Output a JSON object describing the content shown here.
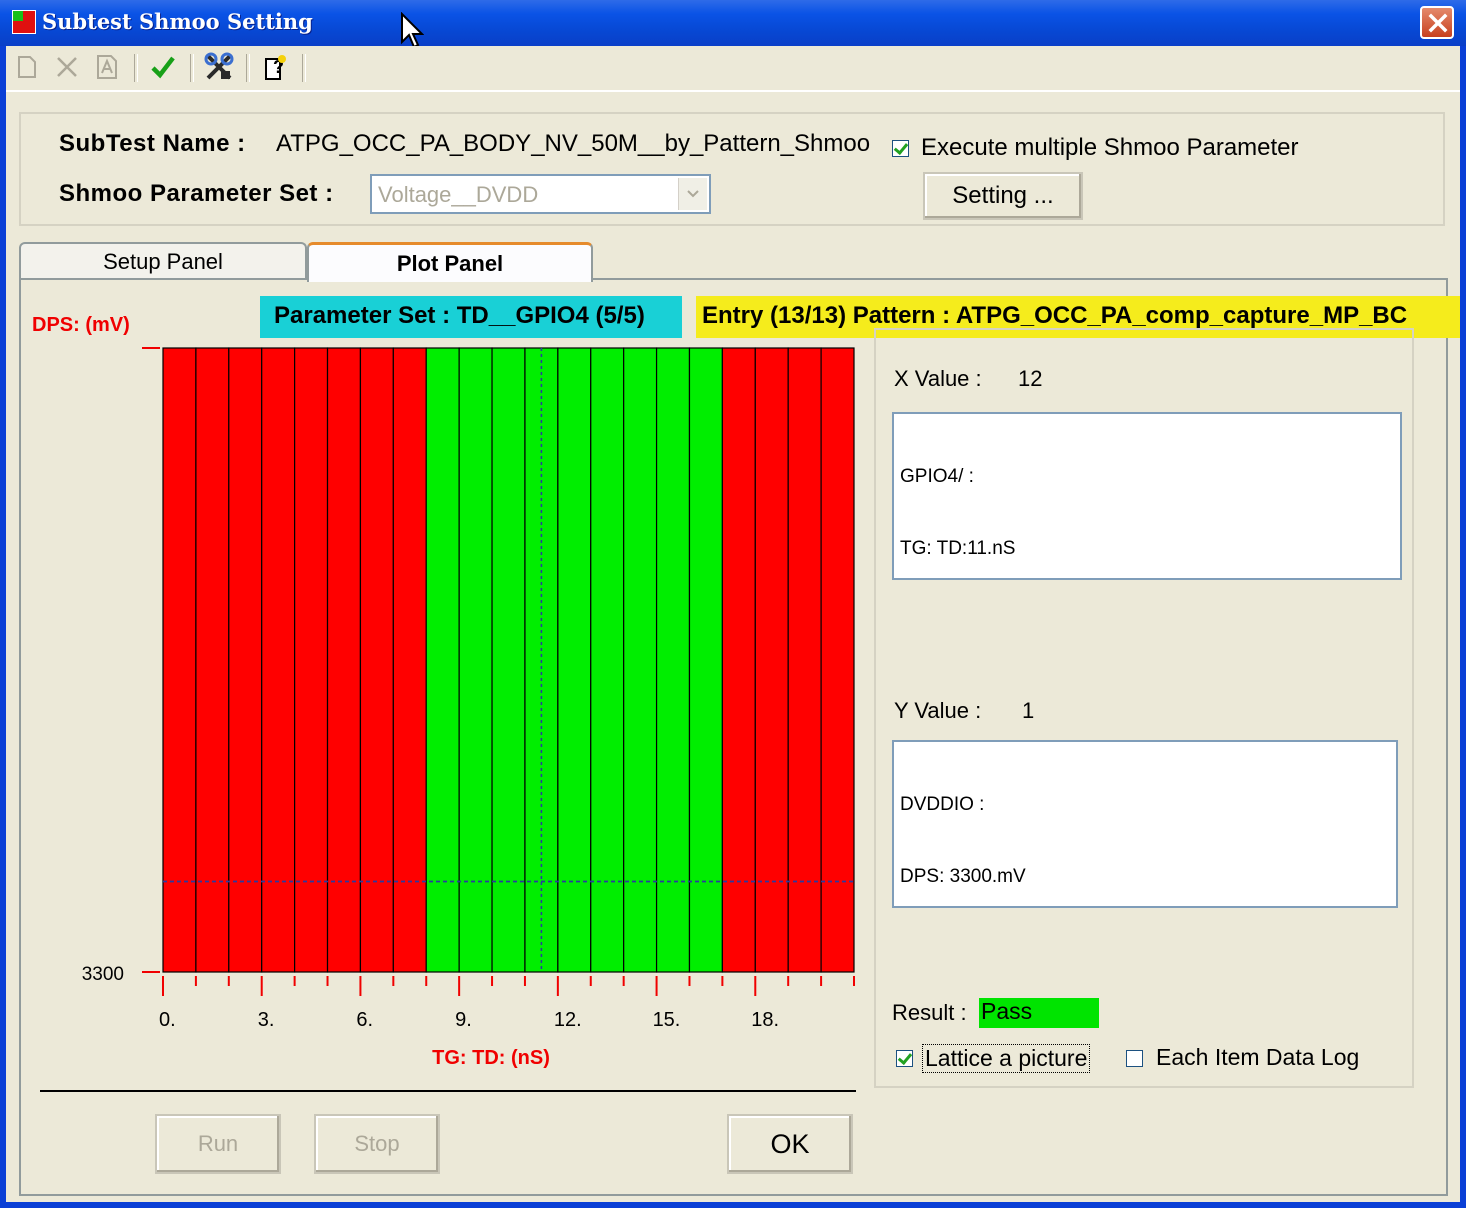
{
  "window": {
    "title": "Subtest Shmoo Setting"
  },
  "toolbar": {
    "icons": [
      "new-icon",
      "delete-icon",
      "rename-icon",
      "check-icon",
      "tools-icon",
      "help-icon"
    ]
  },
  "header": {
    "subtest_label": "SubTest Name :",
    "subtest_value": "ATPG_OCC_PA_BODY_NV_50M__by_Pattern_Shmoo",
    "param_set_label": "Shmoo Parameter Set :",
    "param_set_value": "Voltage__DVDD",
    "execute_multiple_label": "Execute multiple Shmoo Parameter",
    "execute_multiple_checked": true,
    "setting_button": "Setting ..."
  },
  "tabs": [
    {
      "label": "Setup Panel",
      "active": false
    },
    {
      "label": "Plot Panel",
      "active": true
    }
  ],
  "plot": {
    "parameter_set_banner": "Parameter Set : TD__GPIO4 (5/5)",
    "entry_banner": "Entry (13/13) Pattern : ATPG_OCC_PA_comp_capture_MP_BC",
    "dps_label": "DPS:  (mV)"
  },
  "chart_data": {
    "type": "heatmap",
    "xlabel": "TG: TD: (nS)",
    "ylabel": "DPS:  (mV)",
    "x_ticks": [
      "0.",
      "3.",
      "6.",
      "9.",
      "12.",
      "15.",
      "18."
    ],
    "y_ticks": [
      "3300"
    ],
    "x_range": [
      0,
      21
    ],
    "columns": 21,
    "results": [
      "fail",
      "fail",
      "fail",
      "fail",
      "fail",
      "fail",
      "fail",
      "fail",
      "pass",
      "pass",
      "pass",
      "pass",
      "pass",
      "pass",
      "pass",
      "pass",
      "pass",
      "fail",
      "fail",
      "fail",
      "fail"
    ],
    "colors": {
      "pass": "#00ee00",
      "fail": "#ff0000"
    },
    "cursor": {
      "x": 12,
      "y": 1
    }
  },
  "info": {
    "x_value_label": "X Value :",
    "x_value": "12",
    "x_memo_line1": "GPIO4/ :",
    "x_memo_line2": "TG: TD:11.nS",
    "y_value_label": "Y Value :",
    "y_value": "1",
    "y_memo_line1": "DVDDIO :",
    "y_memo_line2": "DPS: 3300.mV",
    "result_label": "Result :",
    "result_value": "Pass",
    "lattice_label": "Lattice a picture",
    "lattice_checked": true,
    "each_item_label": "Each Item Data Log",
    "each_item_checked": false
  },
  "buttons": {
    "run": "Run",
    "stop": "Stop",
    "ok": "OK"
  }
}
